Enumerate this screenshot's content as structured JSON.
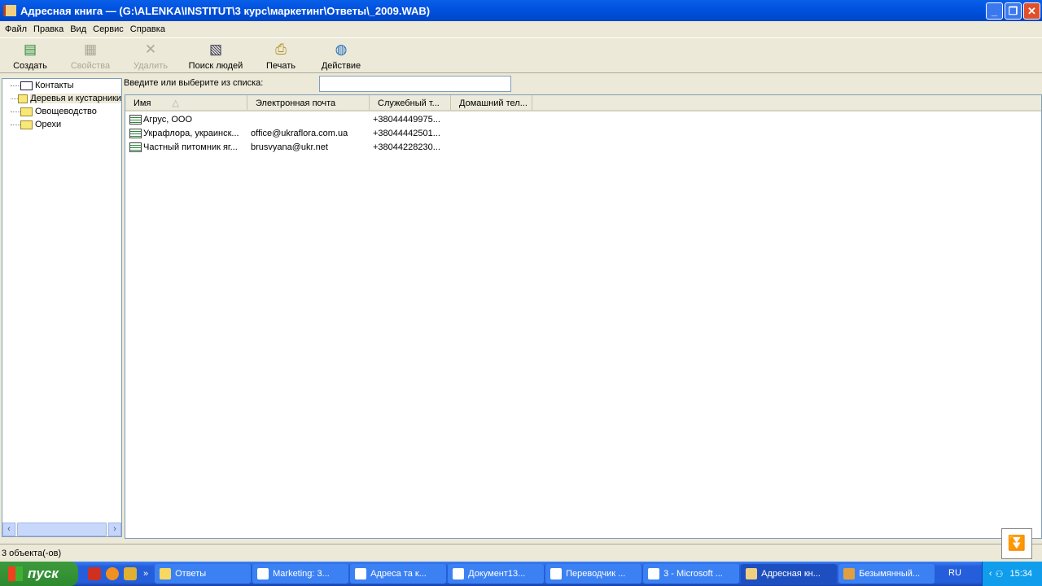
{
  "window": {
    "title": "Адресная книга — (G:\\ALENKA\\INSTITUT\\3 курс\\маркетинг\\Ответы\\_2009.WAB)",
    "minimize": "_",
    "restore": "❐",
    "close": "✕"
  },
  "menu": [
    "Файл",
    "Правка",
    "Вид",
    "Сервис",
    "Справка"
  ],
  "toolbar": [
    {
      "label": "Создать",
      "icon": "new-contact-icon",
      "enabled": true
    },
    {
      "label": "Свойства",
      "icon": "properties-icon",
      "enabled": false
    },
    {
      "label": "Удалить",
      "icon": "delete-icon",
      "enabled": false
    },
    {
      "label": "Поиск людей",
      "icon": "find-people-icon",
      "enabled": true
    },
    {
      "label": "Печать",
      "icon": "print-icon",
      "enabled": true
    },
    {
      "label": "Действие",
      "icon": "action-icon",
      "enabled": true
    }
  ],
  "tree": [
    "Контакты",
    "Деревья и кустарники",
    "Овощеводство",
    "Орехи"
  ],
  "search": {
    "label": "Введите или выберите из списка:",
    "value": ""
  },
  "columns": [
    "Имя",
    "Электронная почта",
    "Служебный т...",
    "Домашний тел..."
  ],
  "rows": [
    [
      "Агрус, ООО",
      "",
      "+38044449975..."
    ],
    [
      "Украфлора, украинск...",
      "office@ukraflora.com.ua",
      "+38044442501..."
    ],
    [
      "Частный питомник яг...",
      "brusvyana@ukr.net",
      "+38044228230..."
    ]
  ],
  "status": "3 объекта(-ов)",
  "taskbar": {
    "start": "пуск",
    "tasks": [
      "Ответы",
      "Marketing: 3...",
      "Адреса та к...",
      "Документ13...",
      "Переводчик ...",
      "3 - Microsoft ...",
      "Адресная кн...",
      "Безымянный..."
    ],
    "active": 6,
    "lang": "RU",
    "clock": "15:34"
  }
}
